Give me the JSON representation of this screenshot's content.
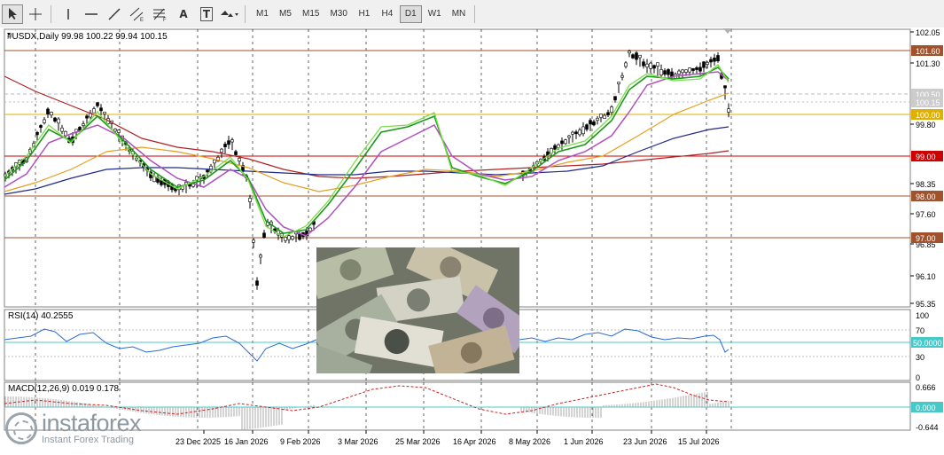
{
  "toolbar": {
    "tools": [
      {
        "name": "cursor-arrow-icon"
      },
      {
        "name": "crosshair-icon"
      },
      {
        "name": "vertical-line-icon"
      },
      {
        "name": "horizontal-line-icon"
      },
      {
        "name": "trend-line-icon"
      },
      {
        "name": "equidistant-channel-icon"
      },
      {
        "name": "fibonacci-icon"
      },
      {
        "name": "text-label-icon",
        "label": "A"
      },
      {
        "name": "text-box-icon",
        "label": "T"
      },
      {
        "name": "shapes-dropdown-icon"
      }
    ],
    "timeframes": [
      "M1",
      "M5",
      "M15",
      "M30",
      "H1",
      "H4",
      "D1",
      "W1",
      "MN"
    ],
    "active_timeframe": "D1"
  },
  "chart": {
    "header": "#USDX,Daily  99.98 100.22 99.94 100.15",
    "price_labels": [
      "102.05",
      "101.30",
      "99.80",
      "98.35",
      "97.60",
      "96.85",
      "96.10",
      "95.35"
    ],
    "level_badges": [
      {
        "text": "101.60",
        "color": "#a0522d"
      },
      {
        "text": "100.50",
        "color": "#cccccc"
      },
      {
        "text": "100.15",
        "color": "#cccccc"
      },
      {
        "text": "100.00",
        "color": "#e0b000"
      },
      {
        "text": "99.00",
        "color": "#cc0000"
      },
      {
        "text": "98.00",
        "color": "#a0522d"
      },
      {
        "text": "97.00",
        "color": "#a0522d"
      }
    ],
    "dates": [
      "23 Dec 2025",
      "16 Jan 2026",
      "9 Feb 2026",
      "3 Mar 2026",
      "25 Mar 2026",
      "16 Apr 2026",
      "8 May 2026",
      "1 Jun 2026",
      "23 Jun 2026",
      "15 Jul 2026"
    ]
  },
  "rsi": {
    "label": "RSI(14) 40.2555",
    "levels": [
      "100",
      "70",
      "50.0000",
      "30",
      "0"
    ]
  },
  "macd": {
    "label": "MACD(12,26,9) 0.019 0.178",
    "levels": [
      "0.666",
      "0.000",
      "-0.644"
    ]
  },
  "watermark": {
    "name": "instaforex",
    "tagline": "Instant Forex Trading"
  },
  "colors": {
    "ma_green": "#1a9a1a",
    "ma_lightgreen": "#7ddc4a",
    "ma_violet": "#b050c0",
    "ma_orange": "#e6a020",
    "ma_navy": "#1f2a8a",
    "ma_red": "#b22222",
    "rsi_line": "#2a6bd6",
    "macd_signal": "#cc2222",
    "level_cyan": "#48c9c9"
  }
}
